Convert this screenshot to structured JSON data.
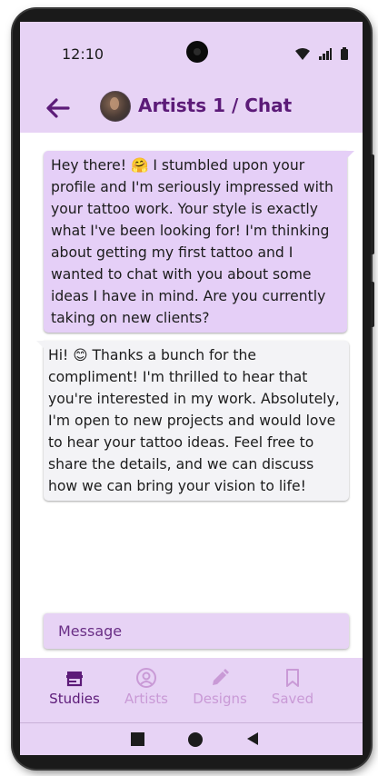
{
  "status_bar": {
    "time": "12:10",
    "icons": [
      "wifi-icon",
      "signal-icon",
      "battery-icon"
    ]
  },
  "header": {
    "title": "Artists 1 / Chat",
    "back_icon": "arrow-left-icon",
    "avatar": "artist-avatar"
  },
  "messages": [
    {
      "direction": "sent",
      "text": "Hey there! 🤗 I stumbled upon your profile and I'm seriously impressed with your tattoo work. Your style is exactly what I've been looking for! I'm thinking about getting my first tattoo and I wanted to chat with you about some ideas I have in mind. Are you currently taking on new clients?"
    },
    {
      "direction": "received",
      "text": "Hi! 😊 Thanks a bunch for the compliment! I'm thrilled to hear that you're interested in my work. Absolutely, I'm open to new projects and would love to hear your tattoo ideas. Feel free to share the details, and we can discuss how we can bring your vision to life!"
    }
  ],
  "composer": {
    "placeholder": "Message",
    "value": ""
  },
  "bottom_nav": {
    "items": [
      {
        "label": "Studies",
        "icon": "storefront-icon",
        "active": true
      },
      {
        "label": "Artists",
        "icon": "account-circle-icon",
        "active": false
      },
      {
        "label": "Designs",
        "icon": "pencil-icon",
        "active": false
      },
      {
        "label": "Saved",
        "icon": "bookmark-icon",
        "active": false
      }
    ]
  },
  "system_nav": {
    "icons": [
      "recents-icon",
      "home-icon",
      "back-icon"
    ]
  },
  "colors": {
    "accent": "#5c1b78",
    "surface": "#e7d3f5",
    "sent_bubble": "#e5cff7",
    "received_bubble": "#f3f3f6",
    "inactive_nav": "#c99ad6"
  }
}
